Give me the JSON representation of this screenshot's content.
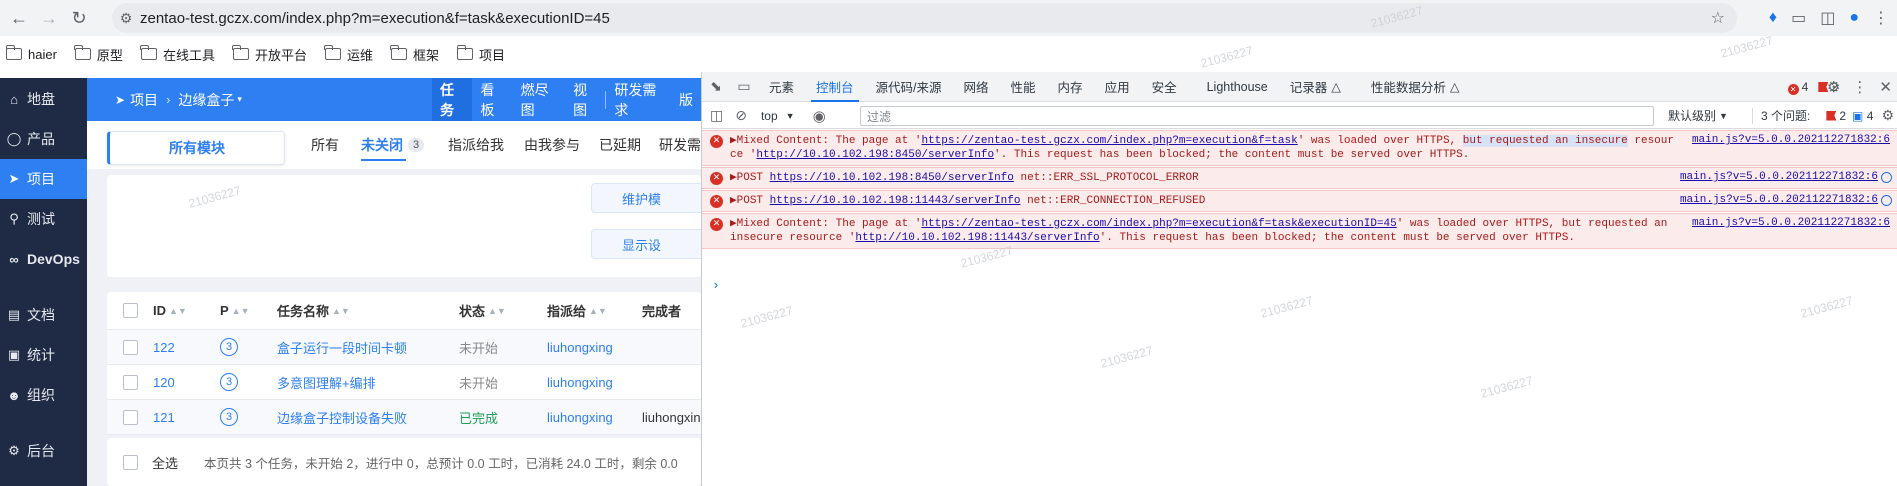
{
  "browser": {
    "url": "zentao-test.gczx.com/index.php?m=execution&f=task&executionID=45",
    "bookmarks": [
      "haier",
      "原型",
      "在线工具",
      "开放平台",
      "运维",
      "框架",
      "项目"
    ]
  },
  "app": {
    "sidebar": [
      {
        "label": "地盘",
        "icon": "pin-icon"
      },
      {
        "label": "产品",
        "icon": "lightbulb-icon"
      },
      {
        "label": "项目",
        "icon": "rocket-icon",
        "active": true
      },
      {
        "label": "测试",
        "icon": "bug-icon"
      },
      {
        "label": "DevOps",
        "icon": "infinity-icon"
      },
      {
        "label": "文档",
        "icon": "document-icon"
      },
      {
        "label": "统计",
        "icon": "chart-icon"
      },
      {
        "label": "组织",
        "icon": "users-icon"
      },
      {
        "label": "后台",
        "icon": "gear-icon"
      }
    ],
    "breadcrumb": {
      "root": "项目",
      "current": "边缘盒子"
    },
    "project_tabs": [
      "任务",
      "看板",
      "燃尽图",
      "视图",
      "研发需求",
      "版"
    ],
    "module_label": "所有模块",
    "filters": [
      {
        "label": "所有"
      },
      {
        "label": "未关闭",
        "count": "3",
        "active": true
      },
      {
        "label": "指派给我"
      },
      {
        "label": "由我参与"
      },
      {
        "label": "已延期"
      },
      {
        "label": "研发需"
      }
    ],
    "options": {
      "maintain_label": "维护模",
      "display_label": "显示设"
    },
    "table": {
      "headers": [
        "ID",
        "P",
        "任务名称",
        "状态",
        "指派给",
        "完成者"
      ],
      "rows": [
        {
          "id": "122",
          "pri": "3",
          "name": "盒子运行一段时间卡顿",
          "status": "未开始",
          "assignee": "liuhongxing",
          "finisher": ""
        },
        {
          "id": "120",
          "pri": "3",
          "name": "多意图理解+编排",
          "status": "未开始",
          "assignee": "liuhongxing",
          "finisher": ""
        },
        {
          "id": "121",
          "pri": "3",
          "name": "边缘盒子控制设备失败",
          "status": "已完成",
          "assignee": "liuhongxing",
          "finisher": "liuhongxin"
        }
      ]
    },
    "footer": {
      "select_all": "全选",
      "summary": "本页共 3 个任务，未开始 2，进行中 0，总预计 0.0 工时，已消耗 24.0 工时，剩余 0.0"
    }
  },
  "devtools": {
    "tabs": [
      "元素",
      "控制台",
      "源代码/来源",
      "网络",
      "性能",
      "内存",
      "应用",
      "安全",
      "Lighthouse",
      "记录器",
      "性能数据分析"
    ],
    "active_tab": "控制台",
    "error_count": "4",
    "issue_count": "2",
    "context": "top",
    "filter_placeholder": "过滤",
    "level": "默认级别",
    "issues_label": "3 个问题:",
    "issues_err": "2",
    "issues_info": "4",
    "messages": [
      {
        "parts": [
          "▶Mixed Content: The page at '",
          "https://zentao-test.gczx.com/index.php?m=execution&f=task",
          "' was loaded over HTTPS, ",
          "but requested an insecure",
          " resource '",
          "http://10.10.102.198:8450/serverInfo",
          "'. This request has been blocked; the content must be served over HTTPS."
        ],
        "source": "main.js?v=5.0.0.2021122718​32:6"
      },
      {
        "parts": [
          "▶POST ",
          "https://10.10.102.198:8450/serverInfo",
          " net::ERR_SSL_PROTOCOL_ERROR"
        ],
        "source": "main.js?v=5.0.0.202112271832:6"
      },
      {
        "parts": [
          "▶POST ",
          "https://10.10.102.198:11443/serverInfo",
          " net::ERR_CONNECTION_REFUSED"
        ],
        "source": "main.js?v=5.0.0.202112271832:6"
      },
      {
        "parts": [
          "▶Mixed Content: The page at '",
          "https://zentao-test.gczx.com/index.php?m=execution&f=task&executionID=45",
          "' was loaded over HTTPS, but requested an insecure resource '",
          "http://10.10.102.198:11443/serverInfo",
          "'. This request has been blocked; the content must be served over HTTPS."
        ],
        "source": "main.js?v=5.0.0.202112271832:6"
      }
    ]
  },
  "watermark": "21036227"
}
